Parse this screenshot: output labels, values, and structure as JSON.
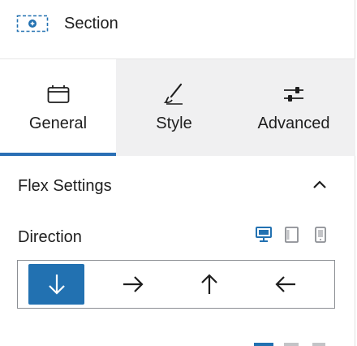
{
  "header": {
    "title": "Section",
    "icon": "section-block-icon"
  },
  "tabs": [
    {
      "label": "General",
      "icon": "calendar-icon",
      "active": true
    },
    {
      "label": "Style",
      "icon": "brush-icon",
      "active": false
    },
    {
      "label": "Advanced",
      "icon": "sliders-icon",
      "active": false
    }
  ],
  "flex_settings": {
    "title": "Flex Settings",
    "expanded": true,
    "direction": {
      "label": "Direction",
      "devices": [
        {
          "name": "desktop",
          "active": true
        },
        {
          "name": "tablet",
          "active": false
        },
        {
          "name": "mobile",
          "active": false
        }
      ],
      "options": [
        {
          "name": "column",
          "icon": "arrow-down-icon",
          "selected": true
        },
        {
          "name": "row",
          "icon": "arrow-right-icon",
          "selected": false
        },
        {
          "name": "column-reverse",
          "icon": "arrow-up-icon",
          "selected": false
        },
        {
          "name": "row-reverse",
          "icon": "arrow-left-icon",
          "selected": false
        }
      ]
    }
  },
  "colors": {
    "accent": "#2271b1",
    "tab_underline": "#2a6fb5",
    "inactive_tab_bg": "#f0f0f1"
  }
}
